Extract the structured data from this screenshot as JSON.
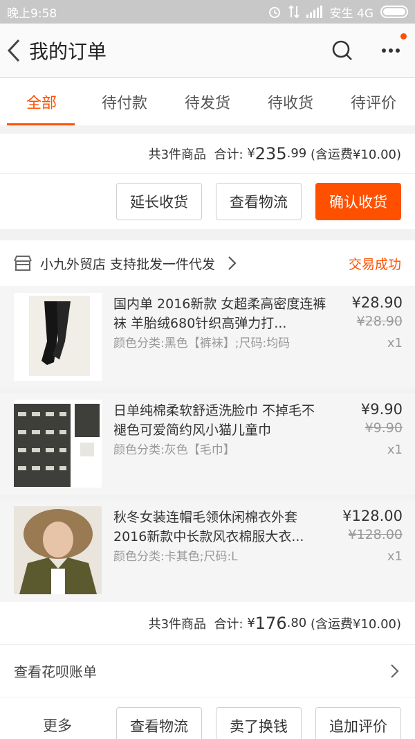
{
  "status_bar": {
    "time": "晚上9:58",
    "carrier": "安生 4G"
  },
  "nav": {
    "title": "我的订单"
  },
  "tabs": [
    "全部",
    "待付款",
    "待发货",
    "待收货",
    "待评价"
  ],
  "order1": {
    "summary": {
      "count": "共3件商品",
      "total_label": "合计:",
      "currency": "¥",
      "total_int": "235",
      "total_dec": ".99",
      "shipping": "(含运费¥10.00)"
    },
    "buttons": {
      "extend": "延长收货",
      "logistics": "查看物流",
      "confirm": "确认收货"
    }
  },
  "order2": {
    "store_name": "小九外贸店  支持批发一件代发",
    "status": "交易成功",
    "items": [
      {
        "title": "国内单 2016新款 女超柔高密度连裤袜 羊胎绒680针织高弹力打...",
        "spec": "颜色分类:黑色【裤袜】;尺码:均码",
        "price": "¥28.90",
        "orig_price": "¥28.90",
        "qty": "x1"
      },
      {
        "title": "日单纯棉柔软舒适洗脸巾 不掉毛不褪色可爱简约风小猫儿童巾",
        "spec": "颜色分类:灰色【毛巾】",
        "price": "¥9.90",
        "orig_price": "¥9.90",
        "qty": "x1"
      },
      {
        "title": "秋冬女装连帽毛领休闲棉衣外套 2016新款中长款风衣棉服大衣...",
        "spec": "颜色分类:卡其色;尺码:L",
        "price": "¥128.00",
        "orig_price": "¥128.00",
        "qty": "x1"
      }
    ],
    "summary": {
      "count": "共3件商品",
      "total_label": "合计:",
      "currency": "¥",
      "total_int": "176",
      "total_dec": ".80",
      "shipping": "(含运费¥10.00)"
    },
    "huabei": "查看花呗账单",
    "buttons": {
      "more": "更多",
      "logistics": "查看物流",
      "sell": "卖了换钱",
      "review": "追加评价"
    }
  },
  "colors": {
    "accent": "#ff5000"
  }
}
